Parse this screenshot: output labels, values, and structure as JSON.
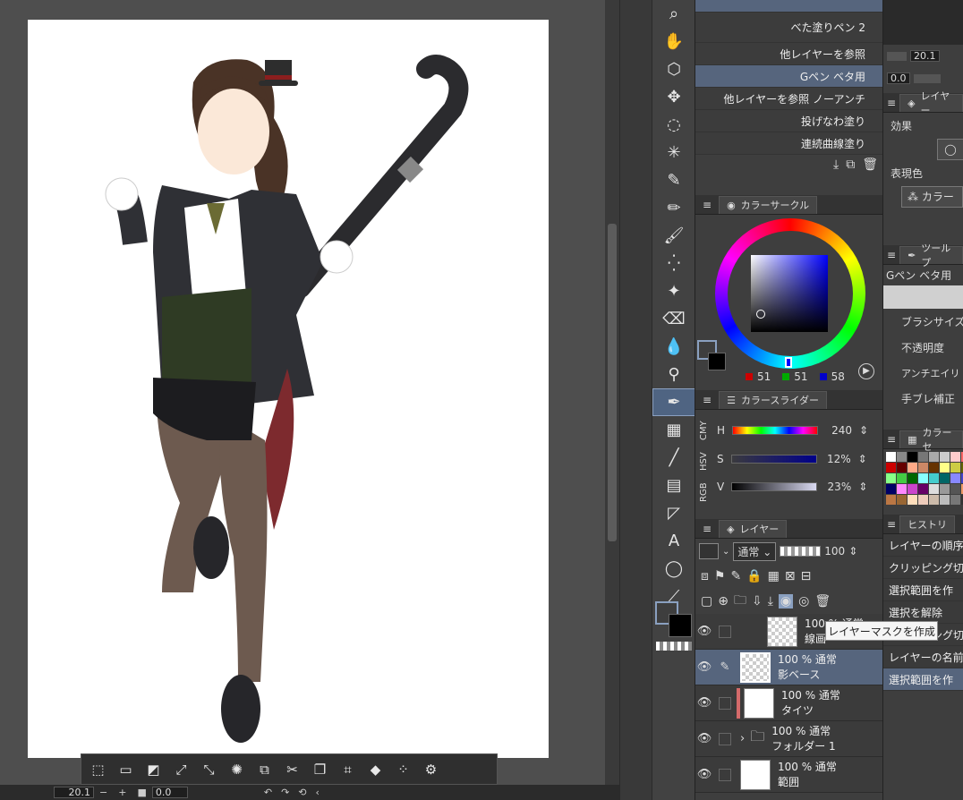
{
  "status_bar": {
    "zoom": "20.1",
    "angle": "0.0"
  },
  "tool_sub": {
    "items": [
      {
        "label": "べた塗りペン 2"
      },
      {
        "label": "他レイヤーを参照"
      },
      {
        "label": "Gペン ベタ用"
      },
      {
        "label": "他レイヤーを参照 ノーアンチ"
      },
      {
        "label": "投げなわ塗り"
      },
      {
        "label": "連続曲線塗り"
      }
    ]
  },
  "color_circle": {
    "title": "カラーサークル",
    "r": "51",
    "g": "51",
    "b": "58"
  },
  "color_slider": {
    "title": "カラースライダー",
    "modes": [
      "RGB",
      "HSV",
      "CMY"
    ],
    "h_label": "H",
    "h_value": "240",
    "s_label": "S",
    "s_value": "12%",
    "v_label": "V",
    "v_value": "23%"
  },
  "layer_panel": {
    "title": "レイヤー",
    "blend_mode": "通常",
    "opacity": "100",
    "layers": [
      {
        "line1": "100 % 通常",
        "line2": "線画"
      },
      {
        "line1": "100 % 通常",
        "line2": "影ベース"
      },
      {
        "line1": "100 % 通常",
        "line2": "タイツ"
      },
      {
        "line1": "100 % 通常",
        "line2": "フォルダー 1"
      },
      {
        "line1": "100 % 通常",
        "line2": "範囲"
      }
    ]
  },
  "tooltip": "レイヤーマスクを作成",
  "props": {
    "zoom": "20.1",
    "angle": "0.0",
    "layer_props_title": "レイヤー",
    "effect_label": "効果",
    "expression_label": "表現色",
    "expression_value": "カラー",
    "tool_props_title": "ツールプ",
    "brush_name": "Gペン ベタ用",
    "brush_size": "ブラシサイズ",
    "opacity": "不透明度",
    "antialias": "アンチエイリ",
    "stabilize": "手ブレ補正",
    "color_set_title": "カラーセ",
    "history_title": "ヒストリ"
  },
  "menu": {
    "items": [
      "レイヤーの順序",
      "クリッピング切り",
      "選択範囲を作",
      "選択を解除",
      "クリッピング切り",
      "レイヤーの名前",
      "選択範囲を作"
    ]
  },
  "colors": {
    "accent": "#56657d",
    "bg": "#3e3e3e",
    "selection": "#4f6482"
  }
}
